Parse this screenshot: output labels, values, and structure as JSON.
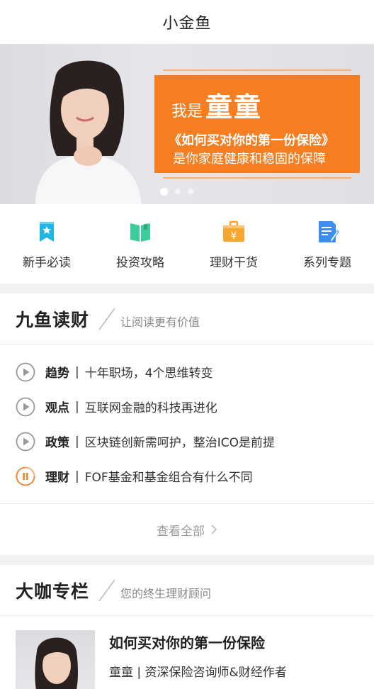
{
  "navbar": {
    "title": "小金鱼"
  },
  "banner": {
    "intro": "我是",
    "name": "童童",
    "book": "《如何买对你的第一份保险》",
    "slogan": "是你家庭健康和稳固的保障",
    "slide_count": 3,
    "active_slide": 1
  },
  "quick_nav": [
    {
      "label": "新手必读",
      "icon": "bookmark-icon",
      "color": "#1fb6e6"
    },
    {
      "label": "投资攻略",
      "icon": "book-icon",
      "color": "#3ccc9c"
    },
    {
      "label": "理财干货",
      "icon": "briefcase-yen-icon",
      "color": "#f7a630"
    },
    {
      "label": "系列专题",
      "icon": "document-pen-icon",
      "color": "#3d8ef0"
    }
  ],
  "reading": {
    "title": "九鱼读财",
    "subtitle": "让阅读更有价值",
    "sep": "|",
    "articles": [
      {
        "tag": "趋势",
        "text": "十年职场，4个思维转变",
        "state": "play"
      },
      {
        "tag": "观点",
        "text": "互联网金融的科技再进化",
        "state": "play"
      },
      {
        "tag": "政策",
        "text": "区块链创新需呵护，整治ICO是前提",
        "state": "play"
      },
      {
        "tag": "理财",
        "text": "FOF基金和基金组合有什么不同",
        "state": "pause"
      }
    ],
    "see_all": "查看全部"
  },
  "columns": {
    "title": "大咖专栏",
    "subtitle": "您的终生理财顾问",
    "card": {
      "title": "如何买对你的第一份保险",
      "author": "童童 | 资深保险咨询师&财经作者"
    }
  },
  "colors": {
    "accent": "#f57d22",
    "play_gray": "#999999"
  }
}
